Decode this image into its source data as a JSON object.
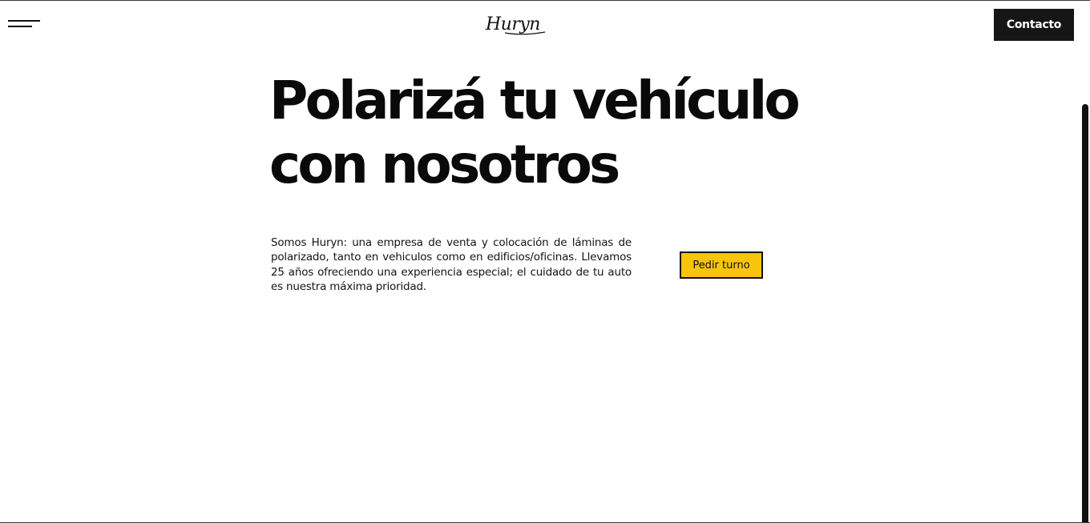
{
  "header": {
    "brand": "Huryn",
    "contact_label": "Contacto"
  },
  "hero": {
    "title_line1": "Polarizá tu vehículo",
    "title_line2": "con nosotros",
    "description": "Somos Huryn: una empresa de venta y colocación de láminas de polarizado, tanto en vehiculos como en edificios/oficinas. Llevamos 25 años ofreciendo una experiencia especial; el cuidado de tu auto es nuestra máxima prioridad.",
    "cta_label": "Pedir turno"
  },
  "icons": {
    "menu": "hamburger-menu-icon"
  },
  "colors": {
    "background": "#ffffff",
    "text": "#0a0a0a",
    "contact_button_bg": "#161616",
    "cta_bg": "#f8c50e",
    "cta_border": "#111111"
  }
}
